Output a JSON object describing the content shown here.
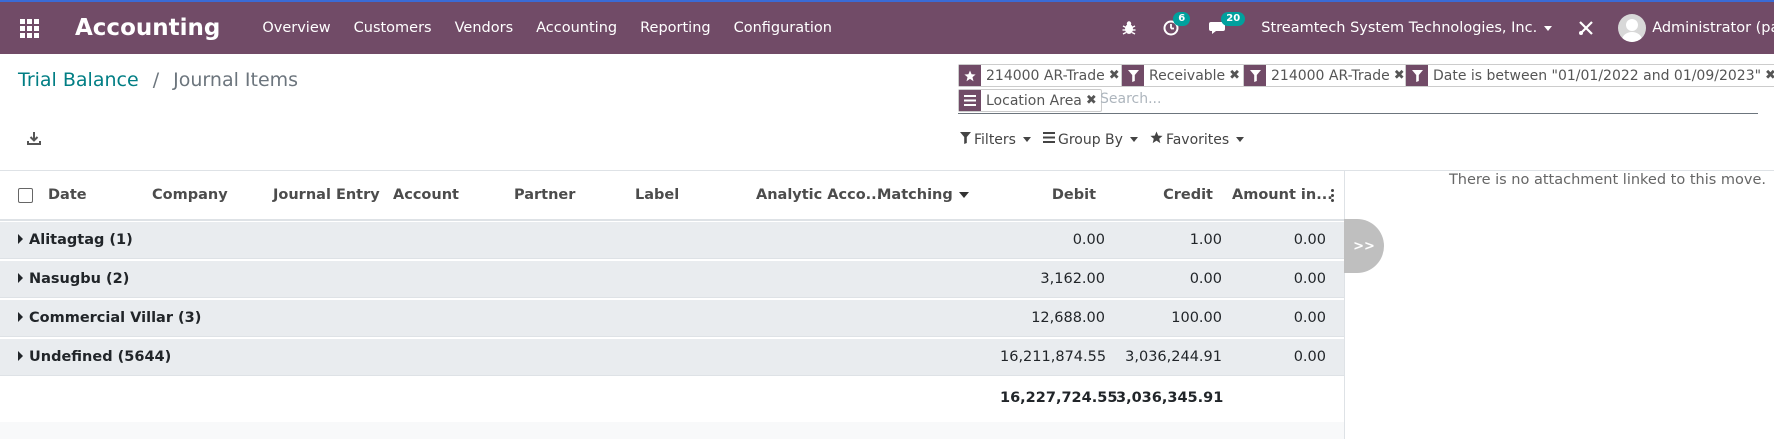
{
  "navbar": {
    "app_name": "Accounting",
    "menu": [
      "Overview",
      "Customers",
      "Vendors",
      "Accounting",
      "Reporting",
      "Configuration"
    ],
    "activity_badge": "6",
    "messages_badge": "20",
    "company": "Streamtech System Technologies, Inc.",
    "user": "Administrator (pavi"
  },
  "breadcrumb": {
    "parent": "Trial Balance",
    "separator": "/",
    "current": "Journal Items"
  },
  "search": {
    "facets": [
      {
        "type": "favorite",
        "label": "214000 AR-Trade"
      },
      {
        "type": "filter",
        "label": "Receivable"
      },
      {
        "type": "filter",
        "label": "214000 AR-Trade"
      },
      {
        "type": "filter",
        "label": "Date is between \"01/01/2022 and 01/09/2023\""
      },
      {
        "type": "groupby",
        "label": "Location Area"
      }
    ],
    "placeholder": "Search...",
    "filters_label": "Filters",
    "groupby_label": "Group By",
    "favorites_label": "Favorites"
  },
  "table": {
    "columns": {
      "date": "Date",
      "company": "Company",
      "journal_entry": "Journal Entry",
      "account": "Account",
      "partner": "Partner",
      "label": "Label",
      "analytic": "Analytic Acco...",
      "matching": "Matching",
      "debit": "Debit",
      "credit": "Credit",
      "amount": "Amount in..."
    },
    "groups": [
      {
        "name": "Alitagtag (1)",
        "debit": "0.00",
        "credit": "1.00",
        "amount": "0.00"
      },
      {
        "name": "Nasugbu (2)",
        "debit": "3,162.00",
        "credit": "0.00",
        "amount": "0.00"
      },
      {
        "name": "Commercial Villar (3)",
        "debit": "12,688.00",
        "credit": "100.00",
        "amount": "0.00"
      },
      {
        "name": "Undefined (5644)",
        "debit": "16,211,874.55",
        "credit": "3,036,244.91",
        "amount": "0.00"
      }
    ],
    "totals": {
      "debit": "16,227,724.55",
      "credit": "3,036,345.91"
    }
  },
  "attachments": {
    "message": "There is no attachment linked to this move.",
    "toggle_label": ">>"
  },
  "colors": {
    "navbar": "#714b67",
    "link": "#017e84",
    "badge": "#00a09d"
  }
}
